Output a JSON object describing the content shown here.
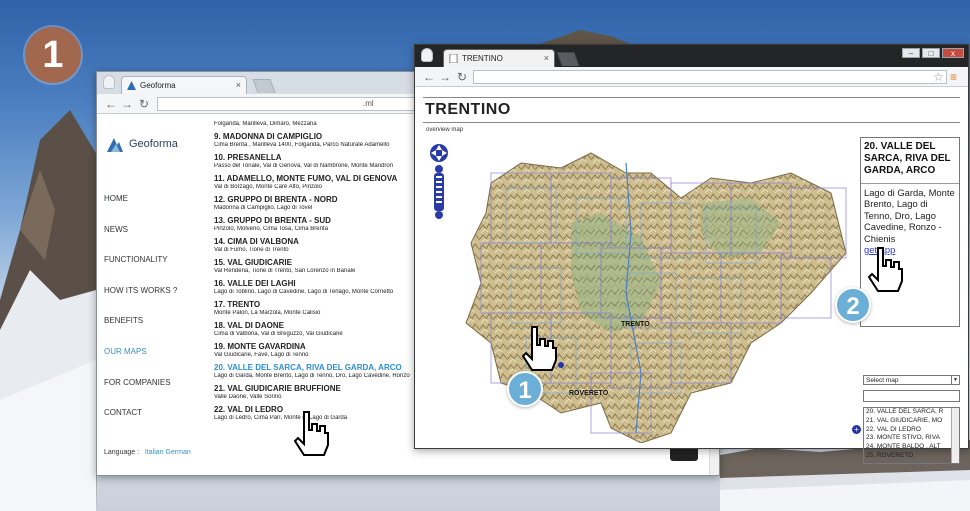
{
  "badge": {
    "step": "1"
  },
  "callouts": {
    "one": "1",
    "two": "2"
  },
  "window1": {
    "tab_title": "Geoforma",
    "url": ".ml",
    "brand": "Geoforma",
    "menu": [
      "HOME",
      "NEWS",
      "FUNCTIONALITY",
      "HOW ITS WORKS ?",
      "BENEFITS",
      "OUR MAPS",
      "FOR COMPANIES",
      "CONTACT"
    ],
    "active_menu": "OUR MAPS",
    "language_label": "Language :",
    "languages": "Italian German",
    "maps": [
      {
        "desc": "Folgarida, Marilleva, Dimaro, Mezzana"
      },
      {
        "title": "9. MADONNA DI CAMPIGLIO",
        "desc": "Cima Brenta , Marilleva 1400, Folgarida, Parco Naturale Adamello"
      },
      {
        "title": "10. PRESANELLA",
        "desc": "Passo del Tonale, Val di Genova, Val di Nambrone, Monte Mandron"
      },
      {
        "title": "11. ADAMELLO, MONTE FUMO, VAL DI GENOVA",
        "desc": "Val di Borzago, Monte Caré Alto, Pinzolo"
      },
      {
        "title": "12. GRUPPO DI BRENTA - NORD",
        "desc": "Madonna di Campiglio, Lago di Tovel"
      },
      {
        "title": "13. GRUPPO DI BRENTA - SUD",
        "desc": "Pinzolo, Molveno, Cima Tosa, Cima Brenta"
      },
      {
        "title": "14. CIMA DI VALBONA",
        "desc": "Val di Fumo, Tione di Trento"
      },
      {
        "title": "15. VAL GIUDICARIE",
        "desc": "Val Rendena, Tione di Trento, San Lorenzo in  Banale"
      },
      {
        "title": "16. VALLE DEI LAGHI",
        "desc": "Lago di Toblino, Lago di Cavedine, Lago di Terlago, Monte Cornetto"
      },
      {
        "title": "17. TRENTO",
        "desc": "Monte Palon, La Marzola, Monte Calisio"
      },
      {
        "title": "18. VAL DI DAONE",
        "desc": "Cima di Valbona, Val di Breguzzo, Val Giudicarie"
      },
      {
        "title": "19. MONTE GAVARDINA",
        "desc": "Val Giudicarie, Favè, Lago di Tenno"
      },
      {
        "title": "20.  VALLE DEL SARCA, RIVA DEL GARDA, ARCO",
        "desc": "Lago di Garda, Monte Brento, Lago di Tenno, Dro, Lago Cavedine, Ronzo",
        "selected": true
      },
      {
        "title": "21. VAL GIUDICARIE  BRUFFIONE",
        "desc": "Valle Daone, Valle Sorino"
      },
      {
        "title": "22. VAL DI LEDRO",
        "desc": "Lago di Ledro, Cima Parì, Monte         o, Lago di Garda"
      }
    ]
  },
  "window2": {
    "tab_title": "TRENTINO",
    "page_title": "TRENTINO",
    "overview_link": "overview map",
    "info_title": "20. VALLE DEL SARCA, RIVA DEL GARDA, ARCO",
    "info_body": "Lago di Garda, Monte Brento, Lago di Tenno, Dro, Lago Cavedine, Ronzo - Chienis",
    "get_app": "get app",
    "select_label": "Select map",
    "list": [
      "20. VALLE DEL SARCA, R",
      "21. VAL GIUDICARIE, MO",
      "22. VAL DI LEDRO",
      "23. MONTE STIVO, RIVA",
      "24. MONTE BALDO , ALT",
      "25. ROVERETO"
    ],
    "map_labels": [
      "TRENTO",
      "ROVERETO"
    ]
  }
}
